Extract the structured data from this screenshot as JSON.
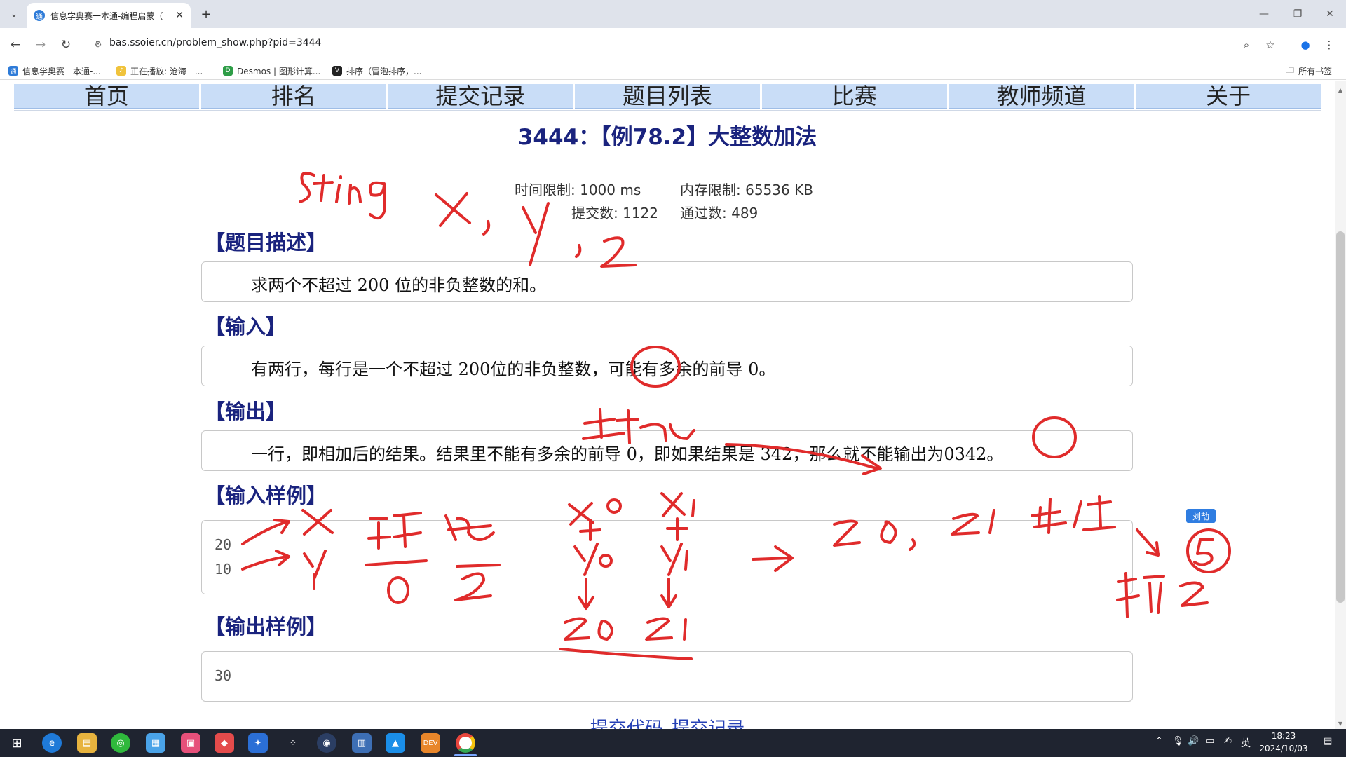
{
  "browser": {
    "tab_title": "信息学奥赛一本通-编程启蒙（",
    "url": "bas.ssoier.cn/problem_show.php?pid=3444",
    "bookmarks": [
      "信息学奥赛一本通-...",
      "正在播放: 沧海一...",
      "Desmos | 图形计算...",
      "排序（冒泡排序，..."
    ],
    "all_bookmarks": "所有书签"
  },
  "nav": [
    "首页",
    "排名",
    "提交记录",
    "题目列表",
    "比赛",
    "教师频道",
    "关于"
  ],
  "problem": {
    "title": "3444：【例78.2】大整数加法",
    "time_limit": "时间限制: 1000 ms",
    "memory_limit": "内存限制: 65536 KB",
    "submissions": "提交数: 1122",
    "accepted": "通过数: 489",
    "desc_heading": "【题目描述】",
    "desc": "求两个不超过 200 位的非负整数的和。",
    "input_heading": "【输入】",
    "input": "有两行，每行是一个不超过 200位的非负整数，可能有多余的前导 0。",
    "output_heading": "【输出】",
    "output": "一行，即相加后的结果。结果里不能有多余的前导 0，即如果结果是 342，那么就不能输出为0342。",
    "sample_in_heading": "【输入样例】",
    "sample_in": "20\n10",
    "sample_out_heading": "【输出样例】",
    "sample_out": "30",
    "links": [
      "提交代码",
      "提交记录"
    ]
  },
  "sticker": "刘劼",
  "taskbar": {
    "time": "18:23",
    "datetime": "2024/10/03 18:23:05",
    "ime": "英"
  },
  "colors": {
    "nav_bg": "#c9ddf7",
    "title": "#1a237e",
    "ink": "#e02b2b",
    "taskbar": "#1f2430"
  }
}
